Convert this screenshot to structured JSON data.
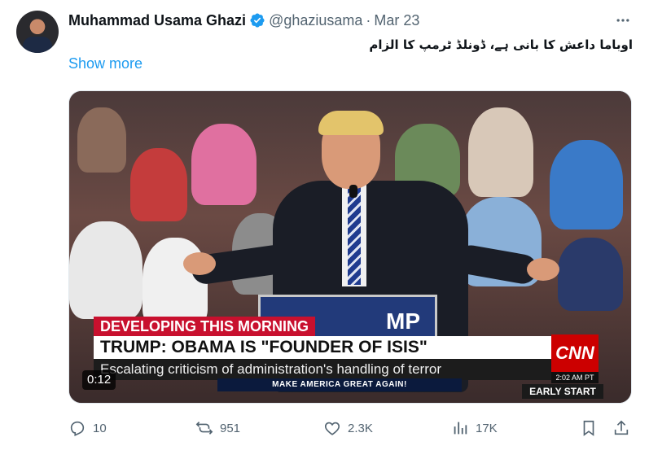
{
  "tweet": {
    "author_name": "Muhammad Usama Ghazi",
    "handle": "@ghaziusama",
    "separator": "·",
    "date": "Mar 23",
    "text": "اوباما داعش کا بانی ہے، ڈونلڈ ٹرمپ کا الزام",
    "show_more": "Show more"
  },
  "media": {
    "duration": "0:12",
    "chyron_top": "DEVELOPING THIS MORNING",
    "chyron_headline": "TRUMP: OBAMA IS \"FOUNDER OF ISIS\"",
    "chyron_sub": "Escalating criticism of administration's handling of terror",
    "podium_text": "MP",
    "maga_line": "MAKE AMERICA GREAT AGAIN!",
    "network_logo": "CNN",
    "network_time": "2:02 AM PT",
    "show_name": "EARLY START"
  },
  "actions": {
    "replies": "10",
    "reposts": "951",
    "likes": "2.3K",
    "views": "17K"
  },
  "colors": {
    "link": "#1d9bf0",
    "muted": "#536471",
    "verified": "#1d9bf0",
    "cnn_red": "#cc0000"
  }
}
